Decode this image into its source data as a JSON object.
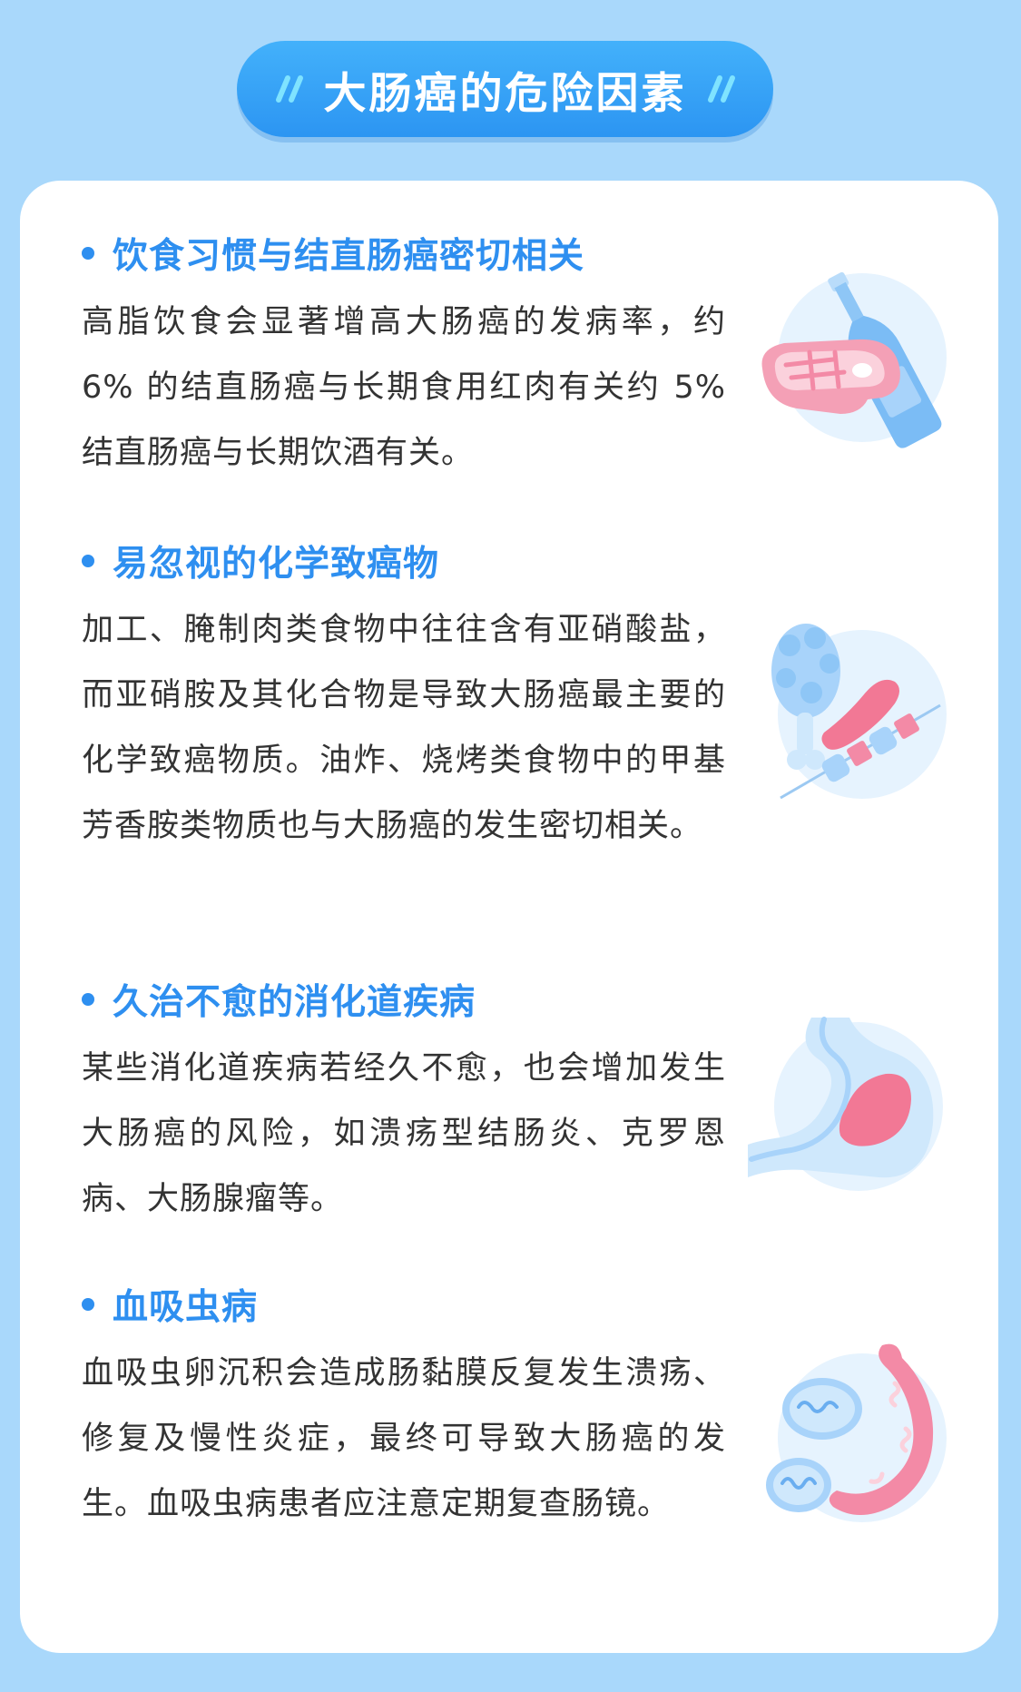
{
  "header": {
    "title": "大肠癌的危险因素",
    "slash_left": "//",
    "slash_right": "//"
  },
  "sections": [
    {
      "heading": "饮食习惯与结直肠癌密切相关",
      "body": "高脂饮食会显著增高大肠癌的发病率，约 6% 的结直肠癌与长期食用红肉有关约 5% 结直肠癌与长期饮酒有关。",
      "icon": "meat-bottle-icon"
    },
    {
      "heading": "易忽视的化学致癌物",
      "body": "加工、腌制肉类食物中往往含有亚硝酸盐，而亚硝胺及其化合物是导致大肠癌最主要的化学致癌物质。油炸、烧烤类食物中的甲基芳香胺类物质也与大肠癌的发生密切相关。",
      "icon": "fried-grilled-food-icon"
    },
    {
      "heading": "久治不愈的消化道疾病",
      "body": "某些消化道疾病若经久不愈，也会增加发生大肠癌的风险，如溃疡型结肠炎、克罗恩病、大肠腺瘤等。",
      "icon": "stomach-icon"
    },
    {
      "heading": "血吸虫病",
      "body": "血吸虫卵沉积会造成肠黏膜反复发生溃疡、修复及慢性炎症，最终可导致大肠癌的发生。血吸虫病患者应注意定期复查肠镜。",
      "icon": "parasite-intestine-icon"
    }
  ],
  "colors": {
    "background": "#a9d8fb",
    "accent_blue": "#2e8ff0",
    "pink": "#f38aa6",
    "light_blue": "#cfe8fc",
    "text": "#333333"
  }
}
